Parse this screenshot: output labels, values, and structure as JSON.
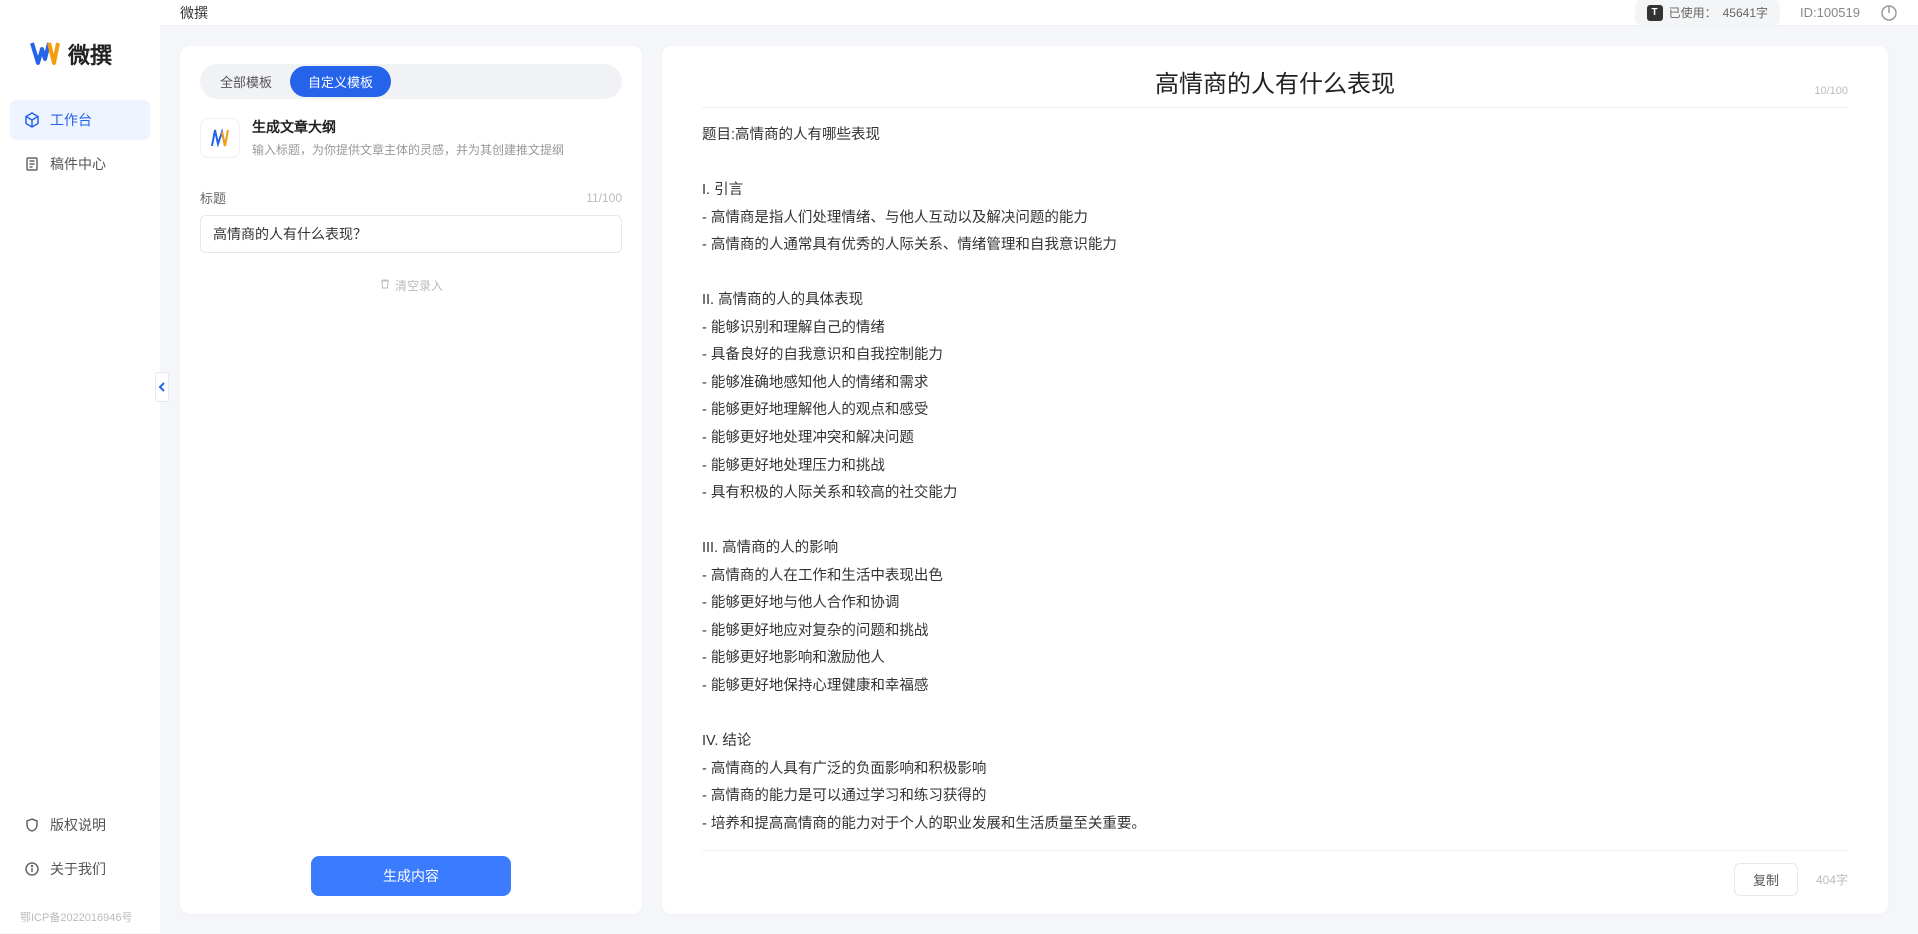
{
  "app": {
    "name": "微撰",
    "icp": "鄂ICP备2022016946号"
  },
  "sidebar": {
    "items": [
      {
        "label": "工作台",
        "icon": "cube"
      },
      {
        "label": "稿件中心",
        "icon": "doc"
      }
    ],
    "bottom": [
      {
        "label": "版权说明",
        "icon": "shield"
      },
      {
        "label": "关于我们",
        "icon": "info"
      }
    ]
  },
  "topbar": {
    "title": "微撰",
    "usage_prefix": "已使用：",
    "usage_value": "45641字",
    "id_label": "ID:100519"
  },
  "left": {
    "tabs": [
      "全部模板",
      "自定义模板"
    ],
    "active_tab": 1,
    "tool": {
      "name": "生成文章大纲",
      "desc": "输入标题，为你提供文章主体的灵感，并为其创建推文提纲"
    },
    "field_label": "标题",
    "field_counter": "11/100",
    "input_value": "高情商的人有什么表现？",
    "clear_label": "清空录入",
    "generate_label": "生成内容"
  },
  "right": {
    "title": "高情商的人有什么表现",
    "title_counter": "10/100",
    "body": "题目:高情商的人有哪些表现\n\nI. 引言\n- 高情商是指人们处理情绪、与他人互动以及解决问题的能力\n- 高情商的人通常具有优秀的人际关系、情绪管理和自我意识能力\n\nII. 高情商的人的具体表现\n- 能够识别和理解自己的情绪\n- 具备良好的自我意识和自我控制能力\n- 能够准确地感知他人的情绪和需求\n- 能够更好地理解他人的观点和感受\n- 能够更好地处理冲突和解决问题\n- 能够更好地处理压力和挑战\n- 具有积极的人际关系和较高的社交能力\n\nIII. 高情商的人的影响\n- 高情商的人在工作和生活中表现出色\n- 能够更好地与他人合作和协调\n- 能够更好地应对复杂的问题和挑战\n- 能够更好地影响和激励他人\n- 能够更好地保持心理健康和幸福感\n\nIV. 结论\n- 高情商的人具有广泛的负面影响和积极影响\n- 高情商的能力是可以通过学习和练习获得的\n- 培养和提高高情商的能力对于个人的职业发展和生活质量至关重要。",
    "copy_label": "复制",
    "word_count": "404字"
  }
}
